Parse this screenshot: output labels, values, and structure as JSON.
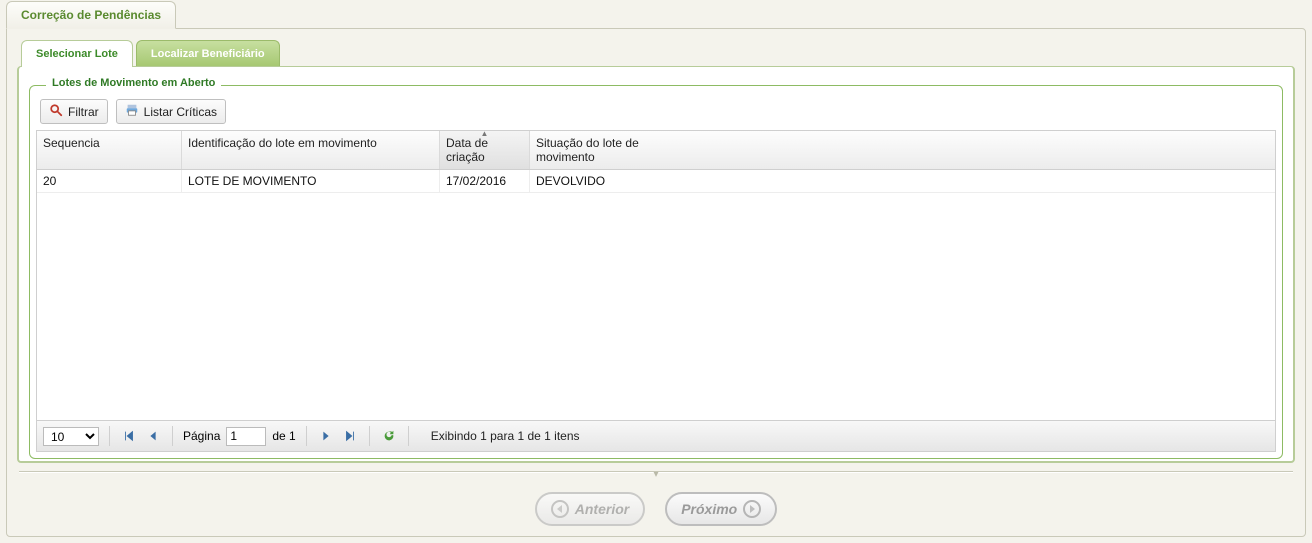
{
  "outer_tab": {
    "title": "Correção de Pendências"
  },
  "inner_tabs": {
    "selecionar": "Selecionar Lote",
    "localizar": "Localizar Beneficiário"
  },
  "fieldset": {
    "legend": "Lotes de Movimento em Aberto"
  },
  "toolbar": {
    "filtrar": "Filtrar",
    "listar_criticas": "Listar Críticas"
  },
  "grid": {
    "headers": {
      "seq": "Sequencia",
      "ident": "Identificação do lote em movimento",
      "data": "Data de criação",
      "sit": "Situação do lote de movimento"
    },
    "rows": [
      {
        "seq": "20",
        "ident": "LOTE DE MOVIMENTO",
        "data": "17/02/2016",
        "sit": "DEVOLVIDO"
      }
    ]
  },
  "pager": {
    "page_size": "10",
    "page_label": "Página",
    "page_current": "1",
    "page_of": "de 1",
    "info": "Exibindo 1 para 1 de 1 itens"
  },
  "wizard": {
    "prev": "Anterior",
    "next": "Próximo"
  }
}
